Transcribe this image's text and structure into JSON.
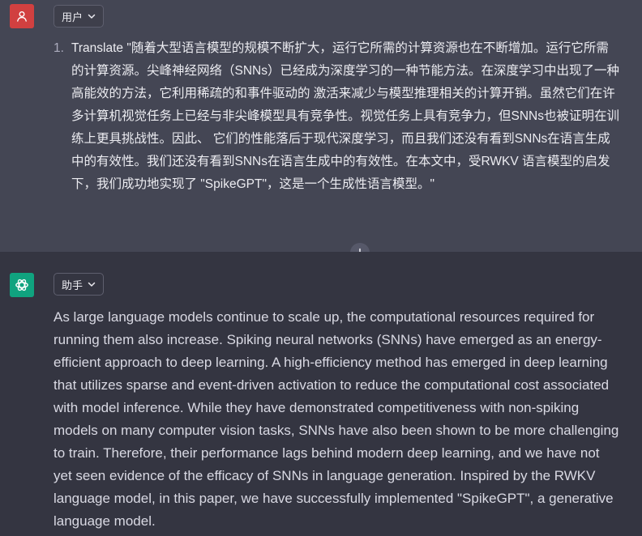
{
  "user_message": {
    "role_label": "用户",
    "avatar_icon": "person-icon",
    "avatar_color": "#d14040",
    "items": [
      {
        "number": "1.",
        "text": "Translate \"随着大型语言模型的规模不断扩大，运行它所需的计算资源也在不断增加。运行它所需的计算资源。尖峰神经网络（SNNs）已经成为深度学习的一种节能方法。在深度学习中出现了一种高能效的方法，它利用稀疏的和事件驱动的 激活来减少与模型推理相关的计算开销。虽然它们在许多计算机视觉任务上已经与非尖峰模型具有竞争性。视觉任务上具有竞争力，但SNNs也被证明在训练上更具挑战性。因此、 它们的性能落后于现代深度学习，而且我们还没有看到SNNs在语言生成中的有效性。我们还没有看到SNNs在语言生成中的有效性。在本文中，受RWKV 语言模型的启发下，我们成功地实现了 \"SpikeGPT\"，这是一个生成性语言模型。\""
      }
    ]
  },
  "assistant_message": {
    "role_label": "助手",
    "avatar_icon": "openai-logo-icon",
    "avatar_color": "#10a37f",
    "text": "As large language models continue to scale up, the computational resources required for running them also increase. Spiking neural networks (SNNs) have emerged as an energy-efficient approach to deep learning. A high-efficiency method has emerged in deep learning that utilizes sparse and event-driven activation to reduce the computational cost associated with model inference. While they have demonstrated competitiveness with non-spiking models on many computer vision tasks, SNNs have also been shown to be more challenging to train. Therefore, their performance lags behind modern deep learning, and we have not yet seen evidence of the efficacy of SNNs in language generation. Inspired by the RWKV language model, in this paper, we have successfully implemented \"SpikeGPT\", a generative language model."
  },
  "insert_button_icon": "plus-icon",
  "colors": {
    "user_bg": "#444654",
    "assistant_bg": "#343541",
    "text": "#ececf1"
  }
}
